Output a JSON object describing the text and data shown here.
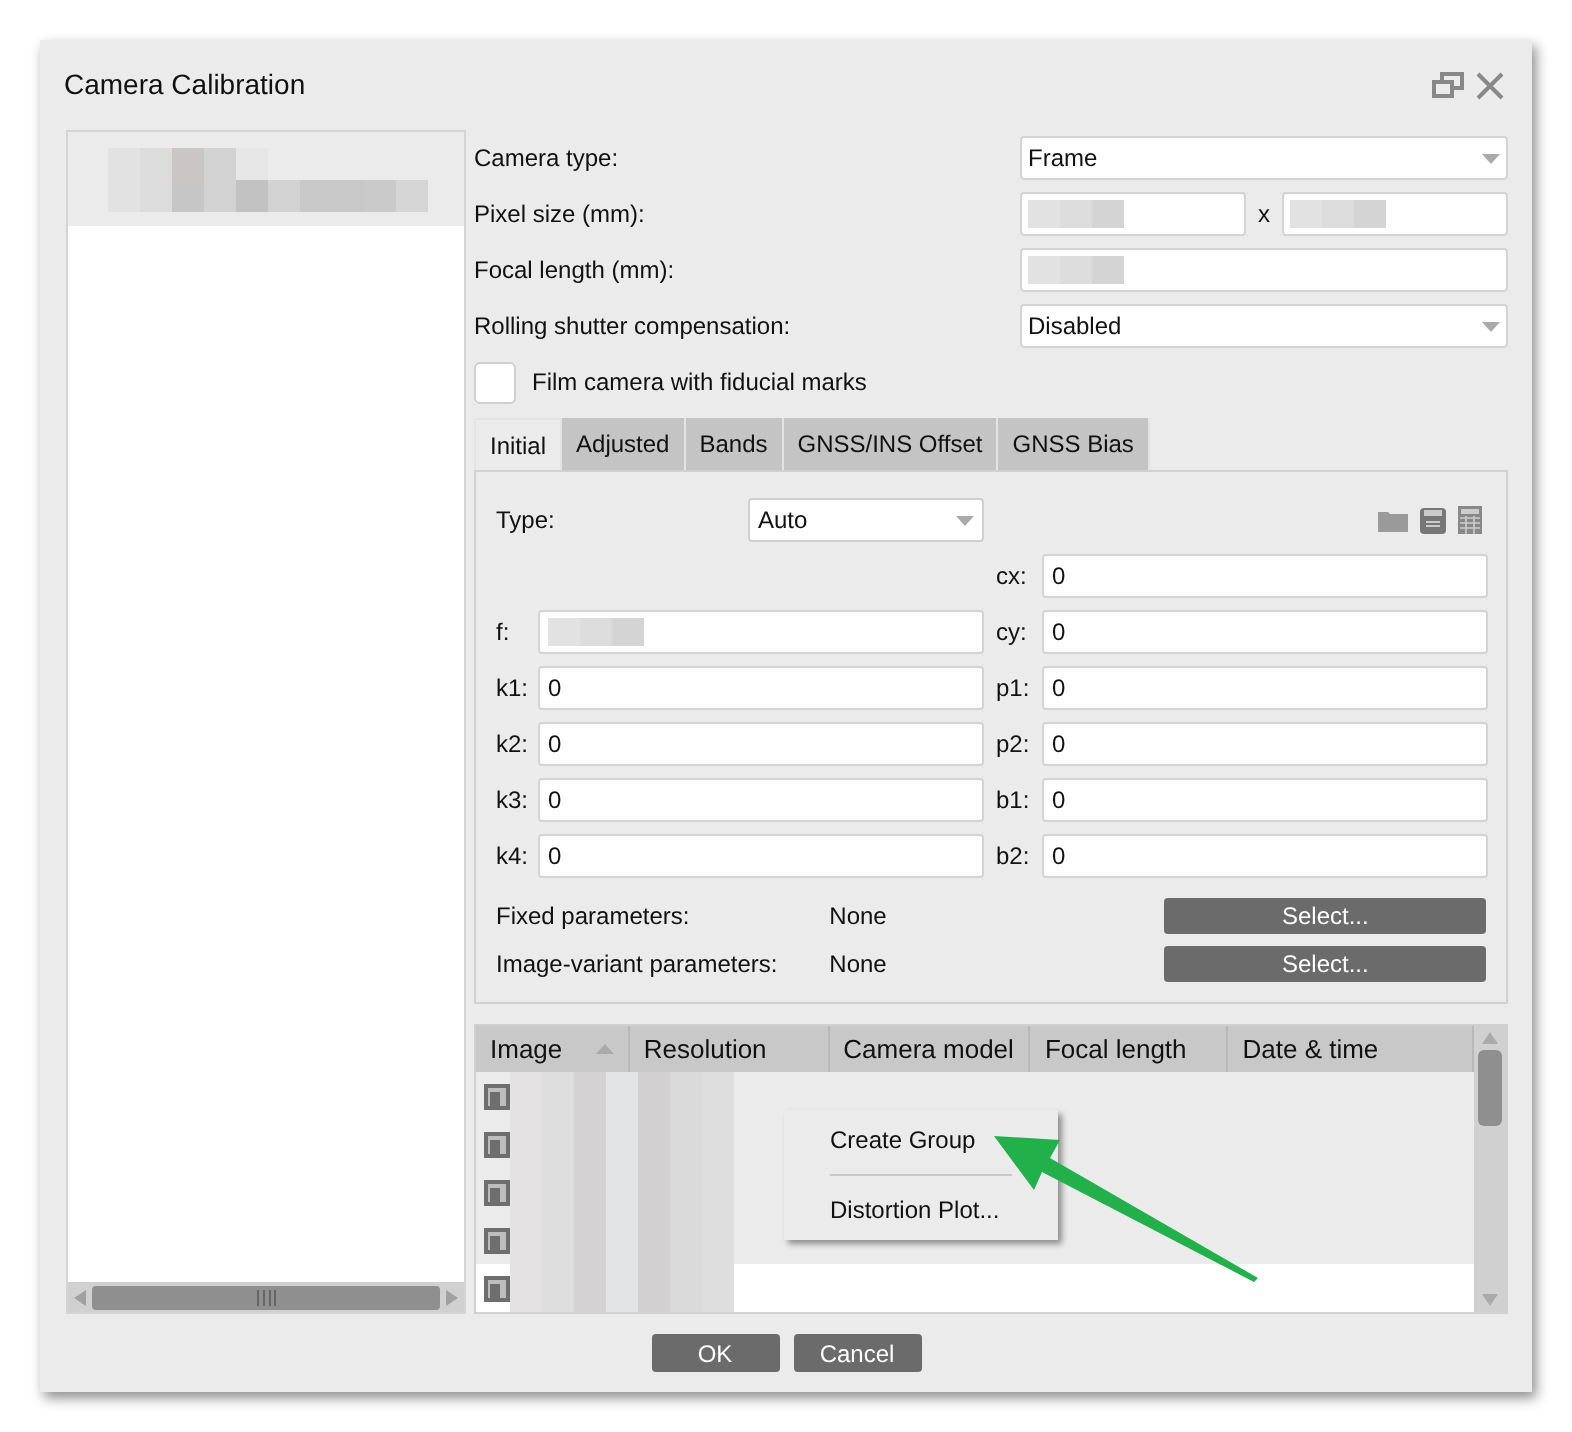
{
  "window": {
    "title": "Camera Calibration"
  },
  "sidebar": {
    "items": [
      {
        "selected": true,
        "redacted": true
      }
    ]
  },
  "form": [
    {
      "kind": "select",
      "label": "Camera type:",
      "value": "Frame"
    },
    {
      "kind": "pair",
      "label": "Pixel size (mm):",
      "separator": "x",
      "redacted": true
    },
    {
      "kind": "text",
      "label": "Focal length (mm):",
      "redacted": true
    },
    {
      "kind": "select",
      "label": "Rolling shutter compensation:",
      "value": "Disabled"
    }
  ],
  "film_checkbox": {
    "label": "Film camera with fiducial marks",
    "checked": false
  },
  "tabs": [
    {
      "label": "Initial",
      "selected": true
    },
    {
      "label": "Adjusted",
      "selected": false
    },
    {
      "label": "Bands",
      "selected": false
    },
    {
      "label": "GNSS/INS Offset",
      "selected": false
    },
    {
      "label": "GNSS Bias",
      "selected": false
    }
  ],
  "type": {
    "label": "Type:",
    "value": "Auto"
  },
  "left_params": [
    {
      "label": "f:",
      "redacted": true
    },
    {
      "label": "k1:",
      "value": "0"
    },
    {
      "label": "k2:",
      "value": "0"
    },
    {
      "label": "k3:",
      "value": "0"
    },
    {
      "label": "k4:",
      "value": "0"
    }
  ],
  "right_params": [
    {
      "label": "cx:",
      "value": "0"
    },
    {
      "label": "cy:",
      "value": "0"
    },
    {
      "label": "p1:",
      "value": "0"
    },
    {
      "label": "p2:",
      "value": "0"
    },
    {
      "label": "b1:",
      "value": "0"
    },
    {
      "label": "b2:",
      "value": "0"
    }
  ],
  "parameter_sets": [
    {
      "label": "Fixed parameters:",
      "value": "None",
      "button": "Select..."
    },
    {
      "label": "Image-variant parameters:",
      "value": "None",
      "button": "Select..."
    }
  ],
  "table": {
    "columns": [
      {
        "label": "Image",
        "sorted": true
      },
      {
        "label": "Resolution",
        "sorted": false
      },
      {
        "label": "Camera model",
        "sorted": false
      },
      {
        "label": "Focal length",
        "sorted": false
      },
      {
        "label": "Date & time",
        "sorted": false
      }
    ],
    "rows": [
      {
        "selected": true
      },
      {
        "selected": true
      },
      {
        "selected": true
      },
      {
        "selected": true
      },
      {
        "selected": false
      }
    ]
  },
  "context_menu": {
    "items": [
      {
        "kind": "item",
        "label": "Create Group"
      },
      {
        "kind": "separator"
      },
      {
        "kind": "item",
        "label": "Distortion Plot..."
      }
    ]
  },
  "annotation": {
    "kind": "arrow"
  },
  "buttons": [
    "OK",
    "Cancel"
  ]
}
